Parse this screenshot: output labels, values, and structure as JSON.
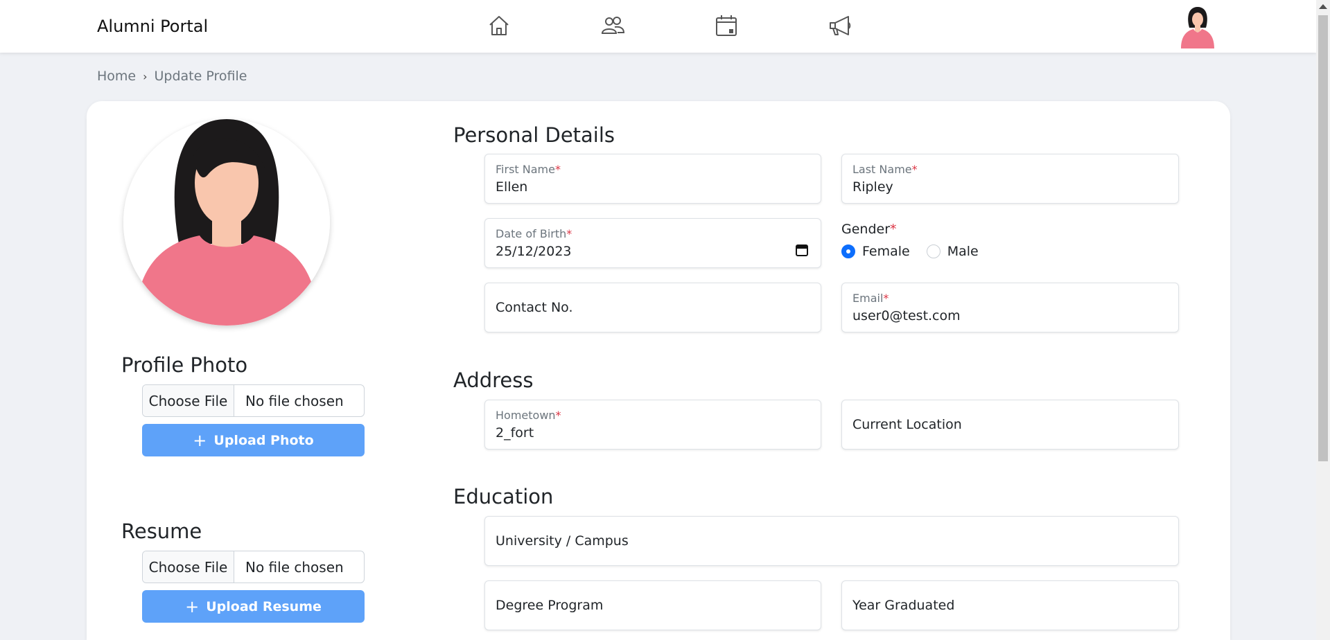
{
  "navbar": {
    "brand": "Alumni Portal",
    "icons": [
      "home-icon",
      "people-icon",
      "calendar-icon",
      "megaphone-icon"
    ]
  },
  "breadcrumb": {
    "home": "Home",
    "separator": "›",
    "current": "Update Profile"
  },
  "sidebar": {
    "profile_photo_title": "Profile Photo",
    "photo_choose_label": "Choose File",
    "photo_file_status": "No file chosen",
    "upload_photo_label": "Upload Photo",
    "resume_title": "Resume",
    "resume_choose_label": "Choose File",
    "resume_file_status": "No file chosen",
    "upload_resume_label": "Upload Resume"
  },
  "personal": {
    "title": "Personal Details",
    "first_name_label": "First Name",
    "first_name_value": "Ellen",
    "last_name_label": "Last Name",
    "last_name_value": "Ripley",
    "dob_label": "Date of Birth",
    "dob_value": "25/12/2023",
    "gender_label": "Gender",
    "gender_options": [
      "Female",
      "Male"
    ],
    "gender_selected": "Female",
    "contact_placeholder": "Contact No.",
    "email_label": "Email",
    "email_value": "user0@test.com",
    "required_mark": "*"
  },
  "address": {
    "title": "Address",
    "hometown_label": "Hometown",
    "hometown_value": "2_fort",
    "current_location_placeholder": "Current Location"
  },
  "education": {
    "title": "Education",
    "university_placeholder": "University / Campus",
    "degree_placeholder": "Degree Program",
    "year_placeholder": "Year Graduated"
  },
  "colors": {
    "accent": "#5ea2f9",
    "radio_checked": "#0d6efd",
    "required": "#dc3545",
    "shirt": "#f0768a",
    "hair": "#1c1a1b",
    "skin": "#f9c6ad"
  }
}
